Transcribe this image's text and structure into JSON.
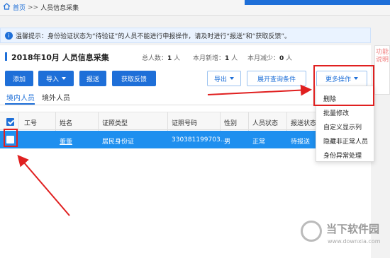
{
  "breadcrumb": {
    "home": "首页",
    "separator": ">>",
    "current": "人员信息采集"
  },
  "notice": {
    "text": "温馨提示：身份验证状态为“待验证”的人员不能进行申报操作，请及时进行“报送”和“获取反馈”。"
  },
  "side_tab": {
    "label": "功能说明"
  },
  "header": {
    "title": "2018年10月  人员信息采集",
    "stats": [
      {
        "label": "总人数：",
        "value": "1",
        "unit": "人"
      },
      {
        "label": "本月新增：",
        "value": "1",
        "unit": "人"
      },
      {
        "label": "本月减少：",
        "value": "0",
        "unit": "人"
      }
    ]
  },
  "toolbar": {
    "add": "添加",
    "import": "导入",
    "submit": "报送",
    "feedback": "获取反馈",
    "export": "导出",
    "expand_query": "展开查询条件",
    "more": "更多操作"
  },
  "tabs": [
    {
      "label": "境内人员",
      "active": true
    },
    {
      "label": "境外人员",
      "active": false
    }
  ],
  "table": {
    "columns": [
      "工号",
      "姓名",
      "证照类型",
      "证照号码",
      "性别",
      "人员状态",
      "报送状态"
    ],
    "rows": [
      {
        "checked": true,
        "id": "",
        "name": "董董",
        "id_type": "居民身份证",
        "id_number": "330381199703...",
        "gender": "男",
        "status": "正常",
        "report_status": "待报送"
      }
    ]
  },
  "more_menu": {
    "items": [
      "删除",
      "批量修改",
      "自定义显示列",
      "隐藏非正常人员",
      "身份异常处理"
    ]
  },
  "watermark": {
    "text": "当下软件园",
    "url": "www.downxia.com"
  },
  "colors": {
    "accent": "#1e6fd8",
    "selected_row": "#1e8fef",
    "annotation": "#e02020"
  }
}
